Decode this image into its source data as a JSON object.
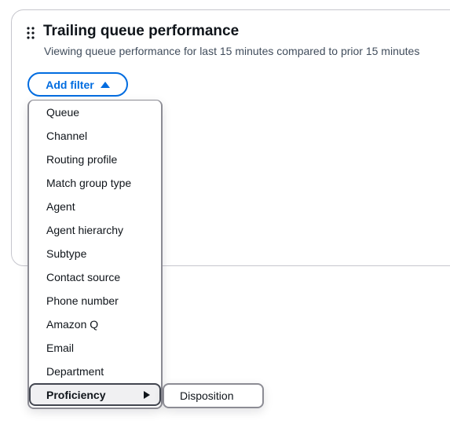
{
  "widget": {
    "title": "Trailing queue performance",
    "subtitle": "Viewing queue performance for last 15 minutes compared to prior 15 minutes",
    "add_filter_label": "Add filter"
  },
  "filter_menu": {
    "items": [
      {
        "label": "Queue"
      },
      {
        "label": "Channel"
      },
      {
        "label": "Routing profile"
      },
      {
        "label": "Match group type"
      },
      {
        "label": "Agent"
      },
      {
        "label": "Agent hierarchy"
      },
      {
        "label": "Subtype"
      },
      {
        "label": "Contact source"
      },
      {
        "label": "Phone number"
      },
      {
        "label": "Amazon Q"
      },
      {
        "label": "Email"
      },
      {
        "label": "Department"
      }
    ],
    "selected_label": "Proficiency",
    "submenu_items": [
      {
        "label": "Disposition"
      }
    ]
  },
  "colors": {
    "accent": "#006ce0",
    "text": "#0f141a",
    "muted_text": "#414d5c",
    "border": "#c6c6cd"
  },
  "icons": {
    "drag": "drag-handle-icon",
    "caret": "caret-up-icon",
    "submenu_arrow": "caret-right-icon"
  }
}
